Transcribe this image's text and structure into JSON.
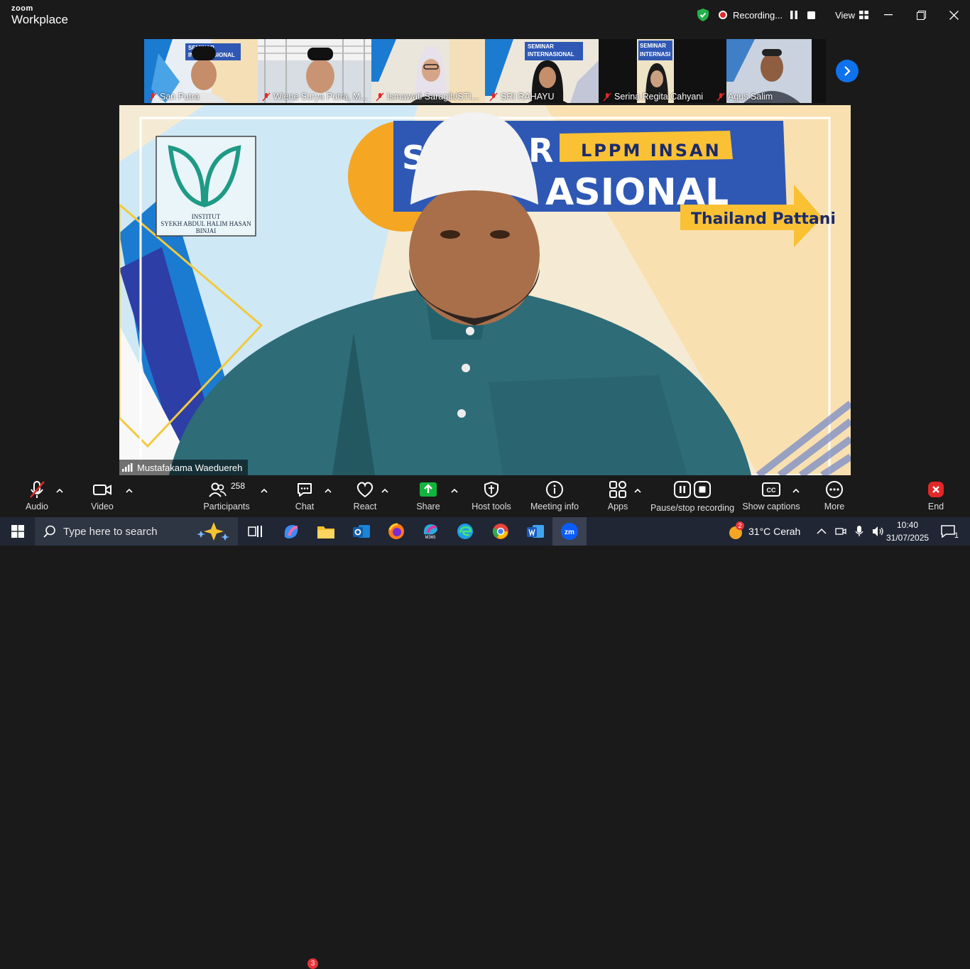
{
  "app": {
    "brand_small": "zoom",
    "brand_large": "Workplace"
  },
  "titlebar": {
    "recording_label": "Recording...",
    "view_label": "View"
  },
  "thumbnails": [
    {
      "name": "San Putra",
      "banner_line1": "SEMINAR",
      "banner_line2": "INTERNASIONAL"
    },
    {
      "name": "Wiene Surya Putra, M..."
    },
    {
      "name": "Ismawati Saragih/STI..."
    },
    {
      "name": "SRI RAHAYU",
      "banner_line1": "SEMINAR",
      "banner_line2": "INTERNASIONAL"
    },
    {
      "name": "Serina Regita Cahyani",
      "banner_line1": "SEMINAR",
      "banner_line2": "INTERNASI"
    },
    {
      "name": "Agus Salim"
    }
  ],
  "main_video": {
    "speaker_name": "Mustafakama Waeduereh",
    "banner_top": "LPPM INSAN",
    "banner_mid_left": "SE",
    "banner_mid_right": "R",
    "banner_main": "ASIONAL",
    "banner_sub": "Thailand Pattani",
    "logo_text_1": "INSTITUT",
    "logo_text_2": "SYEKH ABDUL HALIM HASAN",
    "logo_text_3": "BINJAI"
  },
  "toolbar": {
    "audio": "Audio",
    "video": "Video",
    "participants": "Participants",
    "participants_count": "258",
    "chat": "Chat",
    "chat_badge": "3",
    "react": "React",
    "share": "Share",
    "host_tools": "Host tools",
    "meeting_info": "Meeting info",
    "apps": "Apps",
    "pause_stop": "Pause/stop recording",
    "captions": "Show captions",
    "captions_icon": "CC",
    "more": "More",
    "end": "End"
  },
  "taskbar": {
    "search_placeholder": "Type here to search",
    "weather_badge": "2",
    "weather": "31°C  Cerah",
    "time": "10:40",
    "date": "31/07/2025",
    "notification_count": "1",
    "m365_label": "M365"
  },
  "colors": {
    "accent": "#0e72ed",
    "share_green": "#12b53c",
    "end_red": "#e02828",
    "banner_blue": "#2f58b4",
    "banner_yellow": "#f9c133"
  }
}
